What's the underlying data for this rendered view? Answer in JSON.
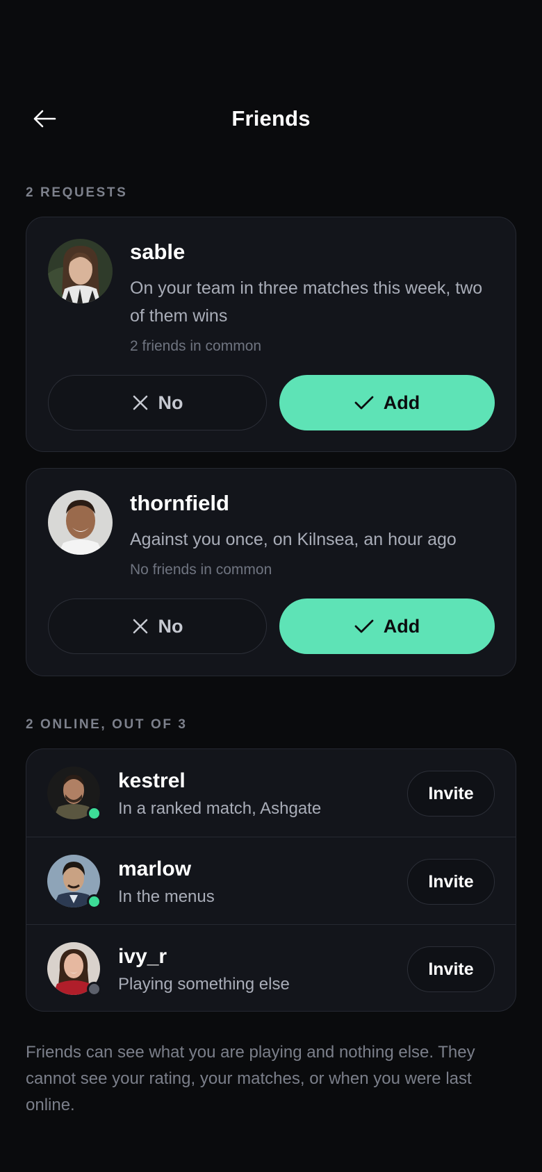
{
  "header": {
    "title": "Friends",
    "back_icon": "arrow-left-icon"
  },
  "requests": {
    "section_label": "2 REQUESTS",
    "items": [
      {
        "name": "sable",
        "description": "On your team in three matches this week, two of them wins",
        "common": "2 friends in common",
        "no_label": "No",
        "add_label": "Add"
      },
      {
        "name": "thornfield",
        "description": "Against you once, on Kilnsea, an hour ago",
        "common": "No friends in common",
        "no_label": "No",
        "add_label": "Add"
      }
    ]
  },
  "online": {
    "section_label": "2 ONLINE, OUT OF 3",
    "friends": [
      {
        "name": "kestrel",
        "status": "In a ranked match, Ashgate",
        "presence": "online",
        "invite_label": "Invite"
      },
      {
        "name": "marlow",
        "status": "In the menus",
        "presence": "online",
        "invite_label": "Invite"
      },
      {
        "name": "ivy_r",
        "status": "Playing something else",
        "presence": "offline",
        "invite_label": "Invite"
      }
    ]
  },
  "footer": {
    "note": "Friends can see what you are playing and nothing else. They cannot see your rating, your matches, or when you were last online."
  },
  "colors": {
    "background": "#0a0b0d",
    "card": "#13151b",
    "accent": "#5ee3b6",
    "online": "#3ddc97",
    "offline": "#5c606b"
  }
}
